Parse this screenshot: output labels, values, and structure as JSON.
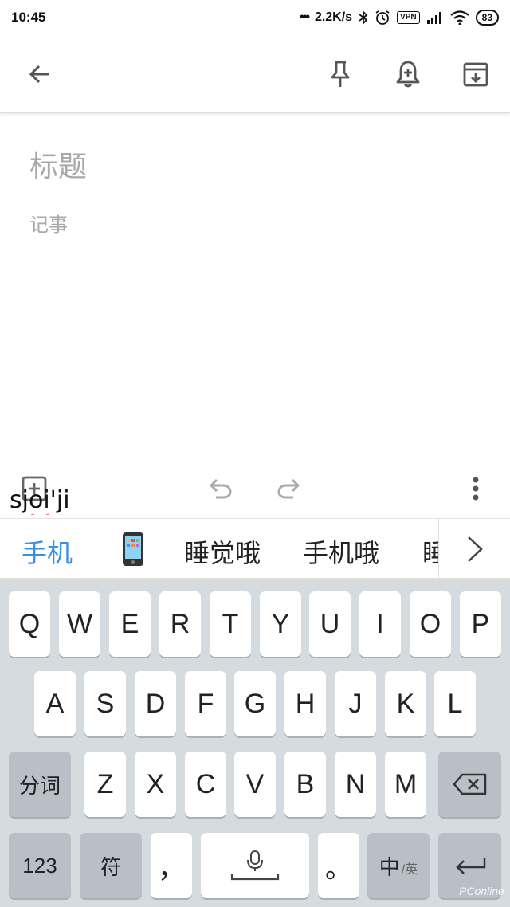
{
  "status_bar": {
    "time": "10:45",
    "network_speed": "2.2K/s",
    "vpn_label": "VPN",
    "battery": "83"
  },
  "note": {
    "title_placeholder": "标题",
    "body_placeholder": "记事"
  },
  "ime": {
    "composing_text": "sjoi'ji",
    "candidates": [
      "手机",
      "睡觉哦",
      "手机哦",
      "睡"
    ],
    "accent_color": "#3d8fe6"
  },
  "keyboard": {
    "row1": [
      "Q",
      "W",
      "E",
      "R",
      "T",
      "Y",
      "U",
      "I",
      "O",
      "P"
    ],
    "row2": [
      "A",
      "S",
      "D",
      "F",
      "G",
      "H",
      "J",
      "K",
      "L"
    ],
    "row3": [
      "Z",
      "X",
      "C",
      "V",
      "B",
      "N",
      "M"
    ],
    "segment_key": "分词",
    "numbers_key": "123",
    "symbols_key": "符",
    "comma_key": "，",
    "period_key": "。",
    "lang_key_main": "中",
    "lang_key_sub": "/英"
  },
  "watermark": "PConline"
}
